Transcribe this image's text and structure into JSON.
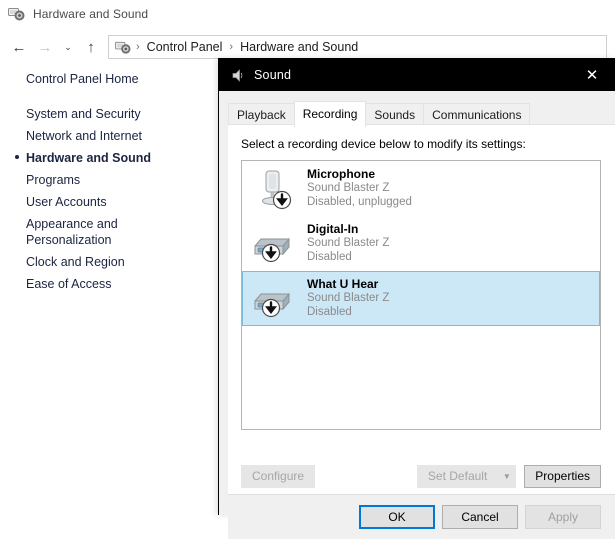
{
  "explorer": {
    "window_title": "Hardware and Sound",
    "window_icon": "hardware-and-sound-icon",
    "nav": {
      "back_icon": "←",
      "forward_icon": "→",
      "recent_icon": "⌄",
      "up_icon": "↑",
      "address_icon": "hardware-and-sound-icon",
      "separator": "›",
      "breadcrumbs": [
        {
          "label": "Control Panel"
        },
        {
          "label": "Hardware and Sound"
        }
      ]
    },
    "sidebar": {
      "home_label": "Control Panel Home",
      "items": [
        {
          "label": "System and Security",
          "current": false
        },
        {
          "label": "Network and Internet",
          "current": false
        },
        {
          "label": "Hardware and Sound",
          "current": true
        },
        {
          "label": "Programs",
          "current": false
        },
        {
          "label": "User Accounts",
          "current": false
        },
        {
          "label": "Appearance and\nPersonalization",
          "current": false
        },
        {
          "label": "Clock and Region",
          "current": false
        },
        {
          "label": "Ease of Access",
          "current": false
        }
      ]
    }
  },
  "dialog": {
    "title": "Sound",
    "title_icon": "speaker-icon",
    "close_icon": "✕",
    "tabs": [
      {
        "label": "Playback",
        "active": false
      },
      {
        "label": "Recording",
        "active": true
      },
      {
        "label": "Sounds",
        "active": false
      },
      {
        "label": "Communications",
        "active": false
      }
    ],
    "prompt": "Select a recording device below to modify its settings:",
    "devices": [
      {
        "name": "Microphone",
        "driver": "Sound Blaster Z",
        "status": "Disabled, unplugged",
        "icon": "microphone-icon",
        "badge": "disabled-arrow-badge",
        "selected": false
      },
      {
        "name": "Digital-In",
        "driver": "Sound Blaster Z",
        "status": "Disabled",
        "icon": "line-in-device-icon",
        "badge": "disabled-arrow-badge",
        "selected": false
      },
      {
        "name": "What U Hear",
        "driver": "Sound Blaster Z",
        "status": "Disabled",
        "icon": "line-in-device-icon",
        "badge": "disabled-arrow-badge",
        "selected": true
      }
    ],
    "buttons": {
      "configure": "Configure",
      "set_default": "Set Default",
      "set_default_arrow": "▼",
      "properties": "Properties",
      "ok": "OK",
      "cancel": "Cancel",
      "apply": "Apply"
    }
  },
  "colors": {
    "selection_fill": "#cce8f7",
    "selection_border": "#7bbbdc",
    "focus_border": "#0078d7",
    "titlebar": "#000000",
    "dialog_bg": "#f0f0f0",
    "muted_text": "#8a8a8a",
    "nav_text": "#1b2440"
  }
}
